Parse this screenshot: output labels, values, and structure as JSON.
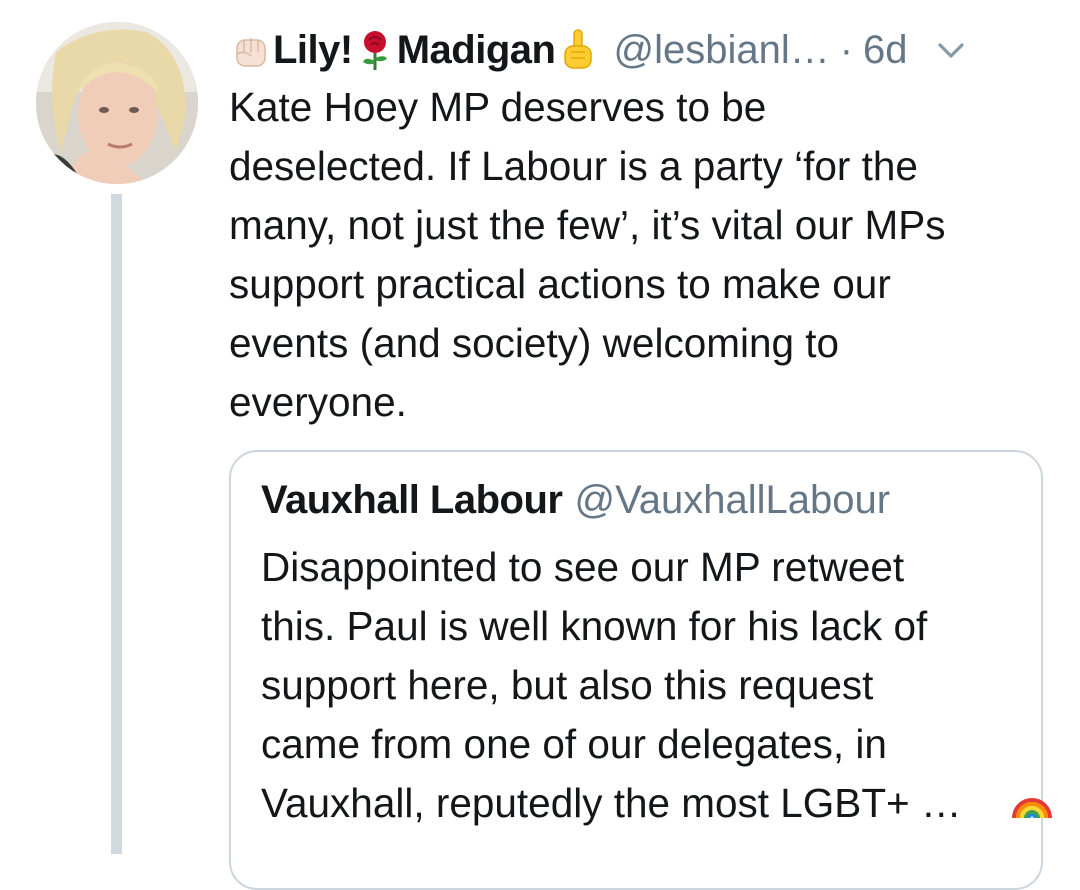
{
  "tweet": {
    "author_name_part1": "Lily!",
    "author_name_part2": "Madigan",
    "handle": "@lesbianl…",
    "separator": "·",
    "time": "6d",
    "lines": [
      "Kate Hoey MP deserves to be",
      "deselected. If Labour is a party ‘for the",
      "many, not just the few’, it’s vital our MPs",
      "support practical actions to make our",
      "events (and society) welcoming to",
      "everyone."
    ],
    "icons": [
      "raised-fist-emoji",
      "rose-emoji",
      "pointing-up-emoji",
      "chevron-down-icon"
    ]
  },
  "quoted_tweet": {
    "author_name": "Vauxhall Labour",
    "handle": "@VauxhallLabour",
    "lines": [
      "Disappointed to see our MP retweet",
      "this. Paul is well known for his lack of",
      "support here, but also this request",
      "came from one of our delegates, in",
      "Vauxhall, reputedly the most LGBT+ …"
    ],
    "icons": [
      "rainbow-emoji"
    ]
  },
  "colors": {
    "text": "#14171a",
    "secondary": "#657786",
    "border": "#ccd6dd",
    "thread_line": "#cfd9de"
  }
}
